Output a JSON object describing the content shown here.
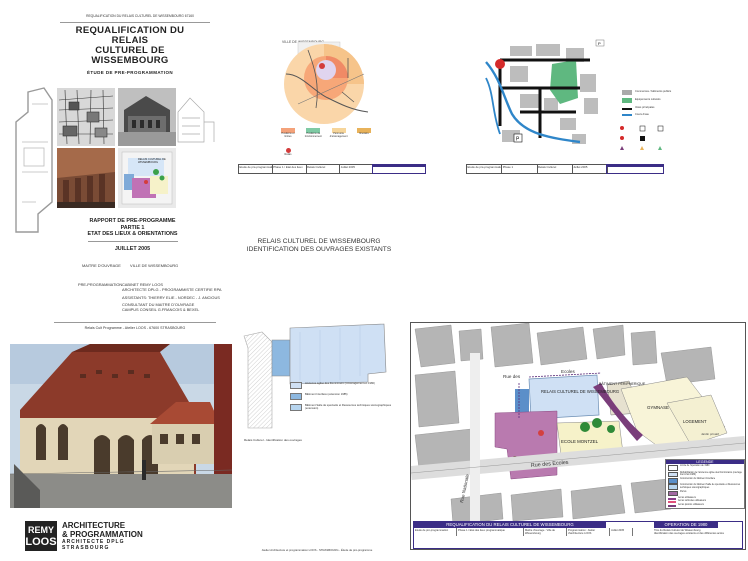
{
  "cover": {
    "header_small": "REQUALIFICATION DU RELAIS CULTUREL DE WISSEMBOURG 67160",
    "title_line1": "REQUALIFICATION DU RELAIS",
    "title_line2": "CULTUREL DE WISSEMBOURG",
    "subtitle": "ÉTUDE DE PRE-PROGRAMMATION",
    "report_line1": "RAPPORT DE PRE-PROGRAMME",
    "report_line2": "PARTIE 1",
    "report_line3": "ETAT DES LIEUX & ORIENTATIONS",
    "date": "JUILLET 2005",
    "moa_label": "MAITRE D'OUVRAGE",
    "moa_value": "VILLE DE WISSEMBOURG",
    "prog_label": "PRE-PROGRAMMATION",
    "prog_lines": [
      "CABINET REMY LOOS",
      "ARCHITECTE DPLG - PROGRAMMISTE CERTIFIE RPA",
      "",
      "ASSISTANTS: THIERRY ELIE - NORDEC - J. ANCIOUS",
      "",
      "CONSULTANT DU MAITRE D'OUVRAGE",
      "CAMPUS CONSEIL G.FRANCOIS & BEXEL"
    ],
    "footer": "Relais Cult Programme - Atelier LOOS - 67600 STRASBOURG",
    "inset_label": "RELAIS CULTUREL DE WISSEMBOURG"
  },
  "panel_title_line1": "RELAIS CULTUREL DE WISSEMBOURG",
  "panel_title_line2": "IDENTIFICATION DES OUVRAGES EXISTANTS",
  "site_plan": {
    "label_bottom": "Relais Culturel - Identification des ouvrages",
    "legend": [
      {
        "text": "Ancienne église des Dominicains (Aménagement en 1980)",
        "color": "#cfe0f4"
      },
      {
        "text": "Bâtiment Interface (extension 1985)",
        "color": "#8db8e0"
      },
      {
        "text": "Bâtiment Salle de spectacle et Ressources techniques scénographiques (extension)",
        "color": "#b7d5ef"
      }
    ]
  },
  "logo": {
    "line1": "REMY",
    "line2": "LOOS",
    "brand1": "ARCHITECTURE",
    "brand2": "& PROGRAMMATION",
    "brand3": "ARCHITECTE DPLG",
    "brand4": "STRASBOURG"
  },
  "bottom_caption": "Atelier Architecture et programmation LOOS - STRASBOURG - Étude de pré-programme",
  "big_map": {
    "streets": {
      "rue_des": "Rue des",
      "rue_ecoles": "Rue des Ecoles",
      "rue_nationale": "Rue Nationale",
      "ecoles_short": "Ecoles"
    },
    "labels": {
      "relais": "RELAIS CULTUREL DE WISSEMBOURG",
      "batiment": "BÂTIMENT PÉRIPHERIQUE",
      "gymnase": "GYMNASE",
      "logement": "LOGEMENT",
      "ecole": "ECOLE MONTZEL",
      "jardin": "Jardin privatif"
    },
    "legend_title": "LEGENDE",
    "legend": [
      {
        "text": "Limite de l'opération de 1980",
        "color": "#ffffff"
      },
      {
        "text": "Réhabilitation de l'ancienne église des Dominicains (ouvrage fourni fait 1980)",
        "color": "#cfe0f4"
      },
      {
        "text": "Construction du bâtiment Interface",
        "color": "#5b8fc9"
      },
      {
        "text": "Construction du bâtiment Salle de spectacle et Ressources techniques scénographiques",
        "color": "#b7d5ef"
      },
      {
        "text": "Parvis",
        "color": "#a36aa3"
      },
      {
        "text": "Accès utilisateurs",
        "color": "#8a3f8a"
      },
      {
        "text": "Accès véhicules utilisateurs",
        "color": "#e14f7a"
      },
      {
        "text": "Accès piétons utilisateurs",
        "color": "#7a3d7a"
      }
    ],
    "cartouche_title": "REQUALIFICATION DU RELAIS CULTUREL DE WISSEMBOURG",
    "cartouche_op": "OPERATION DE 1980",
    "cartouche_cells": [
      "Etude de pré-programmation",
      "Phase 1 / Etat des lieux programmatique",
      "Maître d'ouvrage : Ville de Wissembourg",
      "Programmation : Atelier d'architecture LOOS",
      "Juillet 2005",
      "Titre du Relais Culturel de Wissembourg",
      "Identification des ouvrages existants et des différentes accès"
    ]
  },
  "zone_plan": {
    "top_label": "VILLE DE WISSEMBOURG",
    "legend": [
      {
        "text": "Positions et limites",
        "color": "#f4a27a"
      },
      {
        "text": "Positions de fonctionnement",
        "color": "#7fcaa4"
      },
      {
        "text": "Périmètre d'aménagement",
        "color": "#f6d59a"
      },
      {
        "text": "Itinéraire",
        "color": "#e8b25a"
      }
    ],
    "marker_label": "Relais"
  },
  "street_plan": {
    "legend": [
      {
        "text": "Commerces / bâtiments publics",
        "color": "#aaaaaa"
      },
      {
        "text": "Equipements culturels",
        "color": "#5fb880"
      },
      {
        "text": "Voies principales",
        "color": "#111111"
      },
      {
        "text": "Cours d'eau",
        "color": "#2f86c9"
      }
    ],
    "p_labels": [
      "P",
      "P"
    ]
  },
  "strip_legends": {
    "left": [
      "Etude de pré-programmation",
      "Phase 1 / Etat des lieux",
      "Relais Culturel",
      "Juillet 2005"
    ],
    "right": [
      "Etude de pré-programmation",
      "Phase 1",
      "Relais Culturel",
      "Juillet 2005"
    ]
  }
}
